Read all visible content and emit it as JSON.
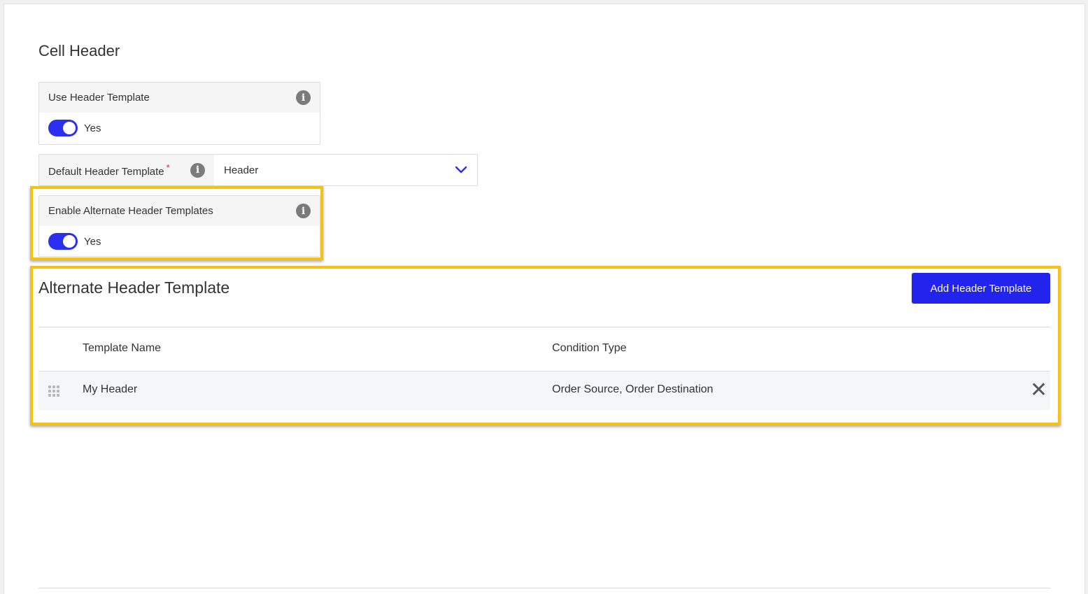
{
  "section": {
    "title": "Cell Header"
  },
  "use_header_template": {
    "label": "Use Header Template",
    "toggle_on": true,
    "toggle_text": "Yes",
    "info_icon": "info-icon"
  },
  "default_header_template": {
    "label": "Default Header Template",
    "required_mark": "*",
    "value": "Header",
    "info_icon": "info-icon",
    "dropdown_icon": "chevron-down-icon"
  },
  "enable_alternate": {
    "label": "Enable Alternate Header Templates",
    "toggle_on": true,
    "toggle_text": "Yes",
    "info_icon": "info-icon"
  },
  "alternate": {
    "title": "Alternate Header Template",
    "add_button": "Add Header Template",
    "columns": [
      "Template Name",
      "Condition Type"
    ],
    "rows": [
      {
        "template_name": "My Header",
        "condition_type": "Order Source, Order Destination",
        "drag_icon": "drag-handle-icon",
        "remove_icon": "close-icon"
      }
    ]
  },
  "colors": {
    "accent": "#2a2ff0",
    "highlight": "#f3c215",
    "button": "#2323ee"
  }
}
